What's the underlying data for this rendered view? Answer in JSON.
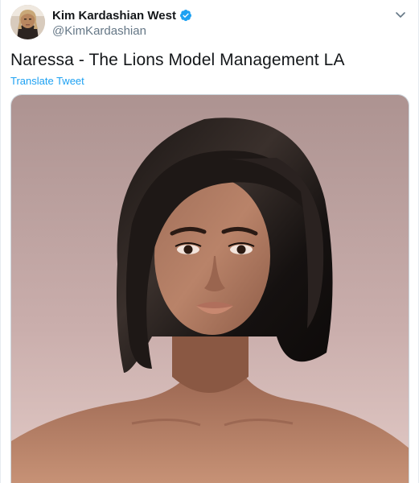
{
  "tweet": {
    "author": {
      "display_name": "Kim Kardashian West",
      "handle": "@KimKardashian",
      "verified": true,
      "avatar_icon": "profile-photo"
    },
    "text": "Naressa - The Lions Model Management LA",
    "translate_label": "Translate Tweet",
    "menu_icon": "chevron-down-icon"
  },
  "colors": {
    "accent": "#1da1f2",
    "text": "#14171a",
    "muted": "#657786",
    "image_background": "#c9afad"
  },
  "media": {
    "type": "photo",
    "alt_icon": "portrait-photo"
  }
}
